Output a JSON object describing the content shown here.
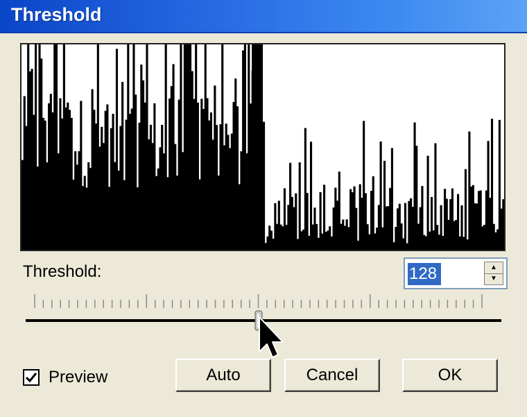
{
  "window": {
    "title": "Threshold"
  },
  "histogram": {
    "threshold_bin": 128,
    "bar_color": "#000000",
    "background_color": "#ffffff"
  },
  "threshold": {
    "label": "Threshold:",
    "value": "128",
    "min": 0,
    "max": 255,
    "slider_position": 0.5
  },
  "preview": {
    "label": "Preview",
    "checked": true
  },
  "buttons": {
    "auto": "Auto",
    "cancel": "Cancel",
    "ok": "OK"
  },
  "colors": {
    "titlebar": "#2a6ee6",
    "selection": "#316ac5",
    "dialog": "#ece9d8"
  }
}
